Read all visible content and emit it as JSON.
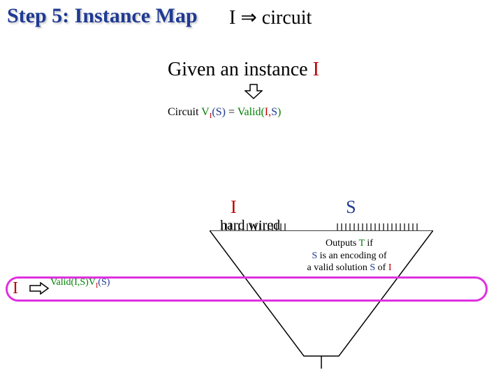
{
  "header": {
    "title": "Step 5: Instance Map"
  },
  "top_formula": {
    "I": "I",
    "arrow": "⇒",
    "target": "circuit"
  },
  "given": {
    "prefix": "Given an instance ",
    "I": "I"
  },
  "circuit_expr": {
    "prefix": "Circuit ",
    "V": "V",
    "sub": "I",
    "S": "(S)",
    "eq": " = ",
    "valid": "Valid(",
    "arg_I": "I,",
    "arg_S": "S",
    "close": ")"
  },
  "inputs": {
    "I": "I",
    "S": "S"
  },
  "hardwired": {
    "text": "hard wired"
  },
  "output": {
    "line1a": "Outputs ",
    "T": "T",
    "line1b": " if",
    "line2a": "",
    "S": "S",
    "line2b": " is an encoding of",
    "line3a": "a valid solution ",
    "S2": "S",
    "line3b": " of ",
    "I": "I"
  },
  "left_map": {
    "I": "I",
    "valid_text": "Valid(I,S)",
    "V": "V",
    "sub": "I",
    "S": "(S)"
  }
}
